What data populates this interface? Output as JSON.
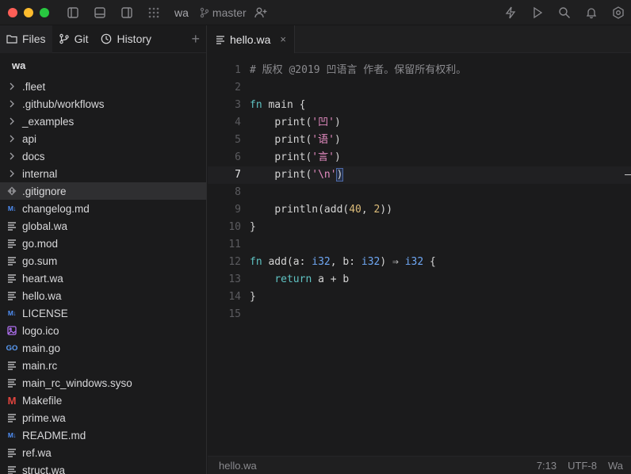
{
  "titlebar": {
    "project": "wa",
    "branch": "master"
  },
  "sidebar": {
    "tabs": [
      {
        "label": "Files"
      },
      {
        "label": "Git"
      },
      {
        "label": "History"
      }
    ],
    "root": "wa",
    "items": [
      {
        "label": ".fleet",
        "icon": "chevron-right-icon"
      },
      {
        "label": ".github/workflows",
        "icon": "chevron-right-icon"
      },
      {
        "label": "_examples",
        "icon": "chevron-right-icon"
      },
      {
        "label": "api",
        "icon": "chevron-right-icon"
      },
      {
        "label": "docs",
        "icon": "chevron-right-icon"
      },
      {
        "label": "internal",
        "icon": "chevron-right-icon"
      },
      {
        "label": ".gitignore",
        "icon": "git-icon"
      },
      {
        "label": "changelog.md",
        "icon": "markdown-icon"
      },
      {
        "label": "global.wa",
        "icon": "text-file-icon"
      },
      {
        "label": "go.mod",
        "icon": "text-file-icon"
      },
      {
        "label": "go.sum",
        "icon": "text-file-icon"
      },
      {
        "label": "heart.wa",
        "icon": "text-file-icon"
      },
      {
        "label": "hello.wa",
        "icon": "text-file-icon"
      },
      {
        "label": "LICENSE",
        "icon": "markdown-icon"
      },
      {
        "label": "logo.ico",
        "icon": "image-icon"
      },
      {
        "label": "main.go",
        "icon": "go-icon"
      },
      {
        "label": "main.rc",
        "icon": "text-file-icon"
      },
      {
        "label": "main_rc_windows.syso",
        "icon": "text-file-icon"
      },
      {
        "label": "Makefile",
        "icon": "makefile-icon"
      },
      {
        "label": "prime.wa",
        "icon": "text-file-icon"
      },
      {
        "label": "README.md",
        "icon": "markdown-icon"
      },
      {
        "label": "ref.wa",
        "icon": "text-file-icon"
      },
      {
        "label": "struct.wa",
        "icon": "text-file-icon"
      }
    ],
    "icon_text": {
      "markdown": "M↓",
      "go": "GO",
      "makefile": "M"
    }
  },
  "editor": {
    "tab_label": "hello.wa",
    "close_glyph": "×",
    "line_numbers": [
      "1",
      "2",
      "3",
      "4",
      "5",
      "6",
      "7",
      "8",
      "9",
      "10",
      "11",
      "12",
      "13",
      "14",
      "15"
    ],
    "code": {
      "l1": "# 版权 @2019 凹语言 作者。保留所有权利。",
      "fn": "fn",
      "main": " main {",
      "indent": "    ",
      "print": "print(",
      "s_ao": "'凹'",
      "s_yu": "'语'",
      "s_yan": "'言'",
      "s_nl": "'\\n'",
      "close_paren": ")",
      "println_a": "println(add(",
      "n40": "40",
      "comma": ", ",
      "n2": "2",
      "println_b": "))",
      "rbrace": "}",
      "add_a": " add(a: ",
      "i32": "i32",
      "add_b": ", b: ",
      "add_c": ") ⇒ ",
      "add_d": " {",
      "ret": "return",
      "ret_expr": " a + b"
    }
  },
  "statusbar": {
    "file": "hello.wa",
    "position": "7:13",
    "encoding": "UTF-8",
    "language": "Wa"
  }
}
